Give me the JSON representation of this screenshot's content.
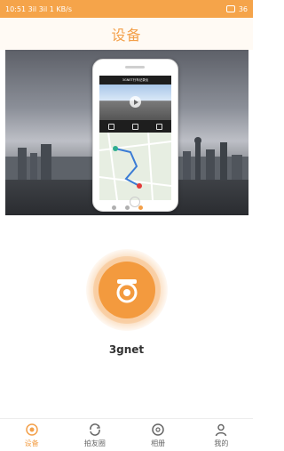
{
  "status_bar": {
    "time": "10:51",
    "signal_text": "3il 3il",
    "speed": "1 KB/s",
    "battery": "36"
  },
  "header": {
    "title": "设备"
  },
  "banner": {
    "phone_screen_title": "3GNET行车记录仪",
    "dots_count": 3,
    "active_dot_index": 2
  },
  "device": {
    "name": "3gnet"
  },
  "tabbar": {
    "tabs": [
      {
        "label": "设备",
        "icon": "camera-icon",
        "active": true
      },
      {
        "label": "拍友圈",
        "icon": "sync-icon",
        "active": false
      },
      {
        "label": "相册",
        "icon": "album-icon",
        "active": false
      },
      {
        "label": "我的",
        "icon": "profile-icon",
        "active": false
      }
    ]
  },
  "colors": {
    "accent": "#f3a04a",
    "status_bar": "#f5a44a",
    "tab_inactive": "#666666"
  }
}
